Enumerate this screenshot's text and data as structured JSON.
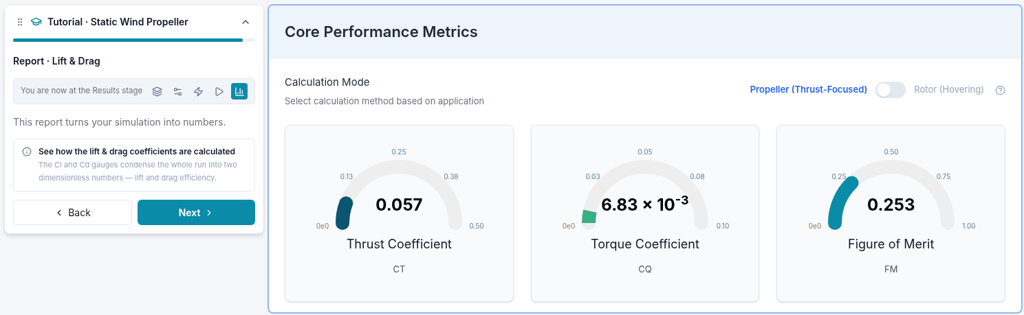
{
  "tutorial": {
    "title": "Tutorial · Static Wind Propeller",
    "expanded": true,
    "progress": {
      "level": 0.95
    },
    "step_title": "Report · Lift & Drag",
    "stage_text": "You are now at the Results stage",
    "stages": [
      {
        "kind": "layers",
        "selected": false
      },
      {
        "kind": "settings",
        "selected": false
      },
      {
        "kind": "zap",
        "selected": false
      },
      {
        "kind": "play",
        "selected": false
      },
      {
        "kind": "chart",
        "selected": true
      }
    ],
    "intro": "This report turns your simulation into numbers.",
    "info": {
      "title": "See how the lift & drag coefficients are calculated",
      "body": "The Cl and Cd gauges condense the whole run into two dimensionless numbers — lift and drag efficiency."
    },
    "buttons": {
      "back": "Back",
      "next": "Next"
    }
  },
  "metrics": {
    "title": "Core Performance Metrics",
    "mode": {
      "label": "Calculation Mode",
      "hint": "Select calculation method based on application",
      "left": "Propeller (Thrust-Focused)",
      "right": "Rotor (Hovering)",
      "on": false
    },
    "gauges": [
      {
        "value": "0.057",
        "name": "Thrust Coefficient",
        "symbol": "CT",
        "color": "#0b5472",
        "kind": "round",
        "ticks": [
          "0e0",
          "0.13",
          "0.25",
          "0.38",
          "0.50"
        ]
      },
      {
        "value": "6.83 × 10$^{-3}$",
        "name": "Torque Coefficient",
        "symbol": "CQ",
        "color": "#3aae85",
        "kind": "square",
        "ticks": [
          "0e0",
          "0.03",
          "0.05",
          "0.08",
          "0.10"
        ]
      },
      {
        "value": "0.253",
        "name": "Figure of Merit",
        "symbol": "FM",
        "color": "#0a8ba8",
        "kind": "round",
        "ticks": [
          "0e0",
          "0.25",
          "0.50",
          "0.75",
          "1.00"
        ]
      }
    ]
  }
}
